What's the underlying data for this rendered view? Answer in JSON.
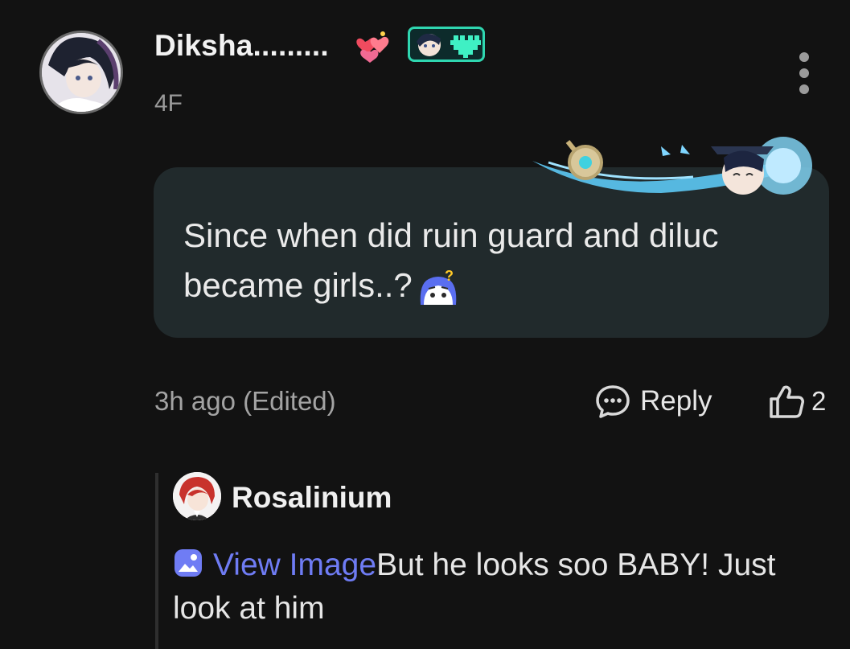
{
  "comment": {
    "username": "Diksha.........",
    "floor": "4F",
    "text": "Since when did ruin guard and diluc became girls..?",
    "timestamp": "3h ago (Edited)",
    "reply_label": "Reply",
    "like_count": "2",
    "colors": {
      "bubble": "#212a2c",
      "accent_frame": "#2fd6b0",
      "link": "#6f7cf4"
    }
  },
  "reply": {
    "username": "Rosalinium",
    "view_image_label": "View Image",
    "text": "But he looks soo BABY! Just look at him"
  },
  "icons": [
    "more-vertical-icon",
    "comment-bubble-icon",
    "thumbs-up-icon",
    "image-icon",
    "confused-emoji-icon",
    "hearts-badge-icon"
  ]
}
